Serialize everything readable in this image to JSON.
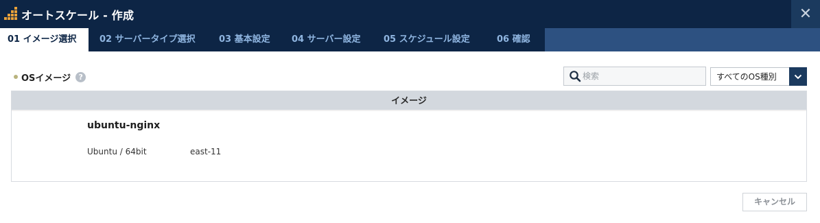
{
  "window": {
    "title": "オートスケール - 作成",
    "icon": "autoscale-bars-icon",
    "close_label": "✕"
  },
  "tabs": [
    {
      "label": "01 イメージ選択",
      "active": true
    },
    {
      "label": "02 サーバータイプ選択",
      "active": false
    },
    {
      "label": "03 基本設定",
      "active": false
    },
    {
      "label": "04 サーバー設定",
      "active": false
    },
    {
      "label": "05 スケジュール設定",
      "active": false
    },
    {
      "label": "06 確認",
      "active": false
    }
  ],
  "section": {
    "title": "OSイメージ",
    "help_label": "?"
  },
  "search": {
    "placeholder": "検索",
    "value": ""
  },
  "os_filter": {
    "selected": "すべてのOS種別"
  },
  "table": {
    "header": "イメージ",
    "rows": [
      {
        "name": "ubuntu-nginx",
        "os": "Ubuntu / 64bit",
        "zone": "east-11"
      }
    ]
  },
  "footer": {
    "cancel_label": "キャンセル"
  },
  "colors": {
    "titlebar": "#0d2545",
    "tabbar": "#2d5181",
    "tab_text": "#8fb5e0",
    "accent_button": "#1b3a5e"
  }
}
